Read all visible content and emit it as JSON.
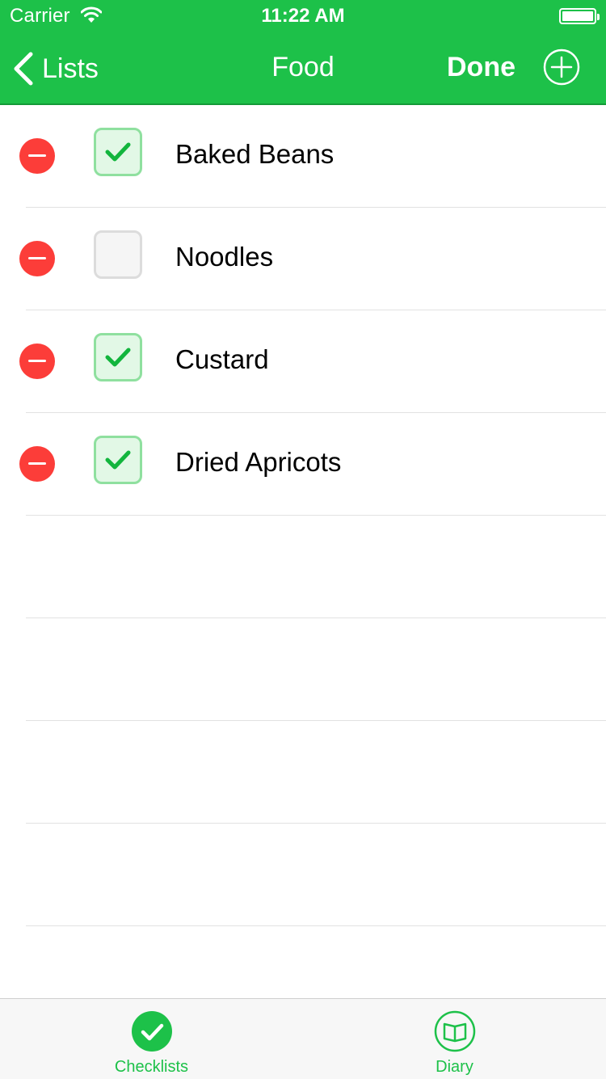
{
  "status_bar": {
    "carrier": "Carrier",
    "time": "11:22 AM",
    "wifi_icon": "wifi-icon",
    "battery_icon": "battery-full-icon"
  },
  "nav": {
    "back_label": "Lists",
    "title": "Food",
    "done_label": "Done",
    "add_icon": "plus-circle-icon"
  },
  "items": [
    {
      "label": "Baked Beans",
      "checked": true
    },
    {
      "label": "Noodles",
      "checked": false
    },
    {
      "label": "Custard",
      "checked": true
    },
    {
      "label": "Dried Apricots",
      "checked": true
    }
  ],
  "tabbar": {
    "checklists_label": "Checklists",
    "diary_label": "Diary"
  },
  "colors": {
    "accent": "#1dc149",
    "delete": "#fc3d39",
    "checkbox_on_bg": "#e2f8e6",
    "checkbox_on_border": "#8fe09f",
    "checkbox_off_border": "#dcdcdc"
  }
}
